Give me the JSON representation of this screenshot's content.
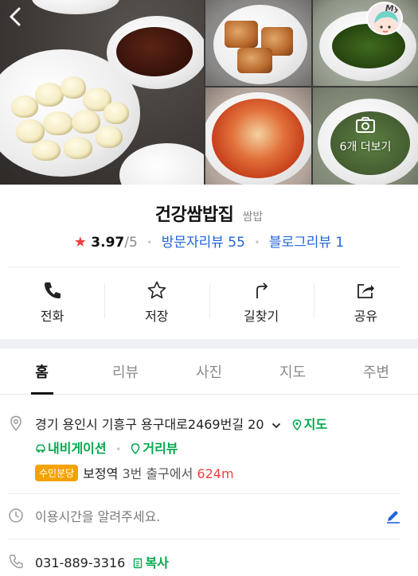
{
  "gallery": {
    "more_label": "6개 더보기",
    "avatar_text": "My"
  },
  "place": {
    "name": "건강쌈밥집",
    "category": "쌈밥",
    "rating": "3.97",
    "rating_max": "/5",
    "visitor_reviews": "방문자리뷰 55",
    "blog_reviews": "블로그리뷰 1"
  },
  "actions": [
    {
      "label": "전화",
      "icon": "phone-icon"
    },
    {
      "label": "저장",
      "icon": "star-outline-icon"
    },
    {
      "label": "길찾기",
      "icon": "directions-icon"
    },
    {
      "label": "공유",
      "icon": "share-icon"
    }
  ],
  "tabs": [
    {
      "label": "홈",
      "active": true
    },
    {
      "label": "리뷰"
    },
    {
      "label": "사진"
    },
    {
      "label": "지도"
    },
    {
      "label": "주변"
    }
  ],
  "info": {
    "address": "경기 용인시 기흥구 용구대로2469번길 20",
    "map_link": "지도",
    "navigation_link": "내비게이션",
    "street_view_link": "거리뷰",
    "subway_line": "수인분당",
    "subway_station": "보정역",
    "subway_exit": "3번 출구에서",
    "subway_distance": "624m",
    "hours_placeholder": "이용시간을 알려주세요.",
    "phone": "031-889-3316",
    "copy_label": "복사"
  },
  "colors": {
    "accent_blue": "#1f64d9",
    "naver_green": "#03a94d",
    "star_red": "#f03e3e",
    "line_badge": "#f5a200"
  }
}
